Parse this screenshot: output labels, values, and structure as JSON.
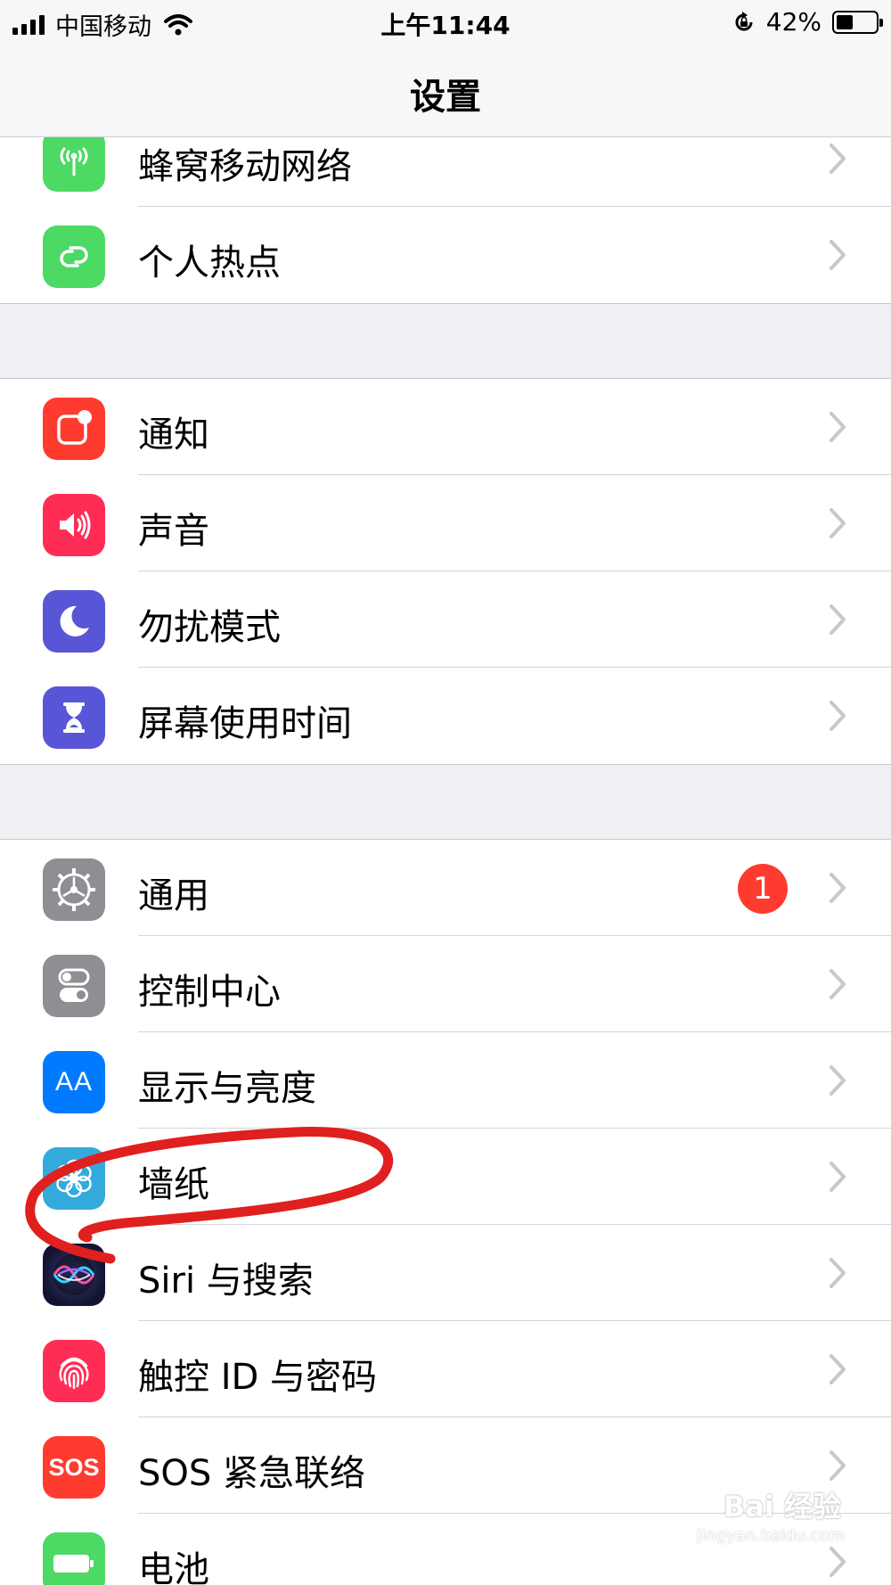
{
  "status_bar": {
    "carrier": "中国移动",
    "time": "上午11:44",
    "battery_percent": "42%",
    "battery_level": 0.42
  },
  "nav": {
    "title": "设置"
  },
  "rows": [
    {
      "label": "蜂窝移动网络",
      "icon": "cellular-antenna-icon",
      "color": "#4cd964"
    },
    {
      "label": "个人热点",
      "icon": "hotspot-link-icon",
      "color": "#4cd964"
    },
    {
      "label": "通知",
      "icon": "notification-icon",
      "color": "#ff3b30"
    },
    {
      "label": "声音",
      "icon": "speaker-icon",
      "color": "#ff2d55"
    },
    {
      "label": "勿扰模式",
      "icon": "moon-icon",
      "color": "#5856d6"
    },
    {
      "label": "屏幕使用时间",
      "icon": "hourglass-icon",
      "color": "#5856d6"
    },
    {
      "label": "通用",
      "icon": "gear-icon",
      "color": "#8e8e93",
      "badge": "1"
    },
    {
      "label": "控制中心",
      "icon": "toggles-icon",
      "color": "#8e8e93"
    },
    {
      "label": "显示与亮度",
      "icon": "text-size-icon",
      "color": "#007aff",
      "icon_text": "AA"
    },
    {
      "label": "墙纸",
      "icon": "flower-icon",
      "color": "#34aadc"
    },
    {
      "label": "Siri 与搜索",
      "icon": "siri-icon",
      "color": "#1c1c3a"
    },
    {
      "label": "触控 ID 与密码",
      "icon": "fingerprint-icon",
      "color": "#ff2d55"
    },
    {
      "label": "SOS 紧急联络",
      "icon": "sos-icon",
      "color": "#ff3b30",
      "icon_text": "SOS"
    },
    {
      "label": "电池",
      "icon": "battery-icon",
      "color": "#4cd964"
    }
  ],
  "annotation": {
    "stroke_color": "#e0201e"
  },
  "watermark": {
    "text": "Bai 经验",
    "sub": "jingyan.baidu.com"
  }
}
